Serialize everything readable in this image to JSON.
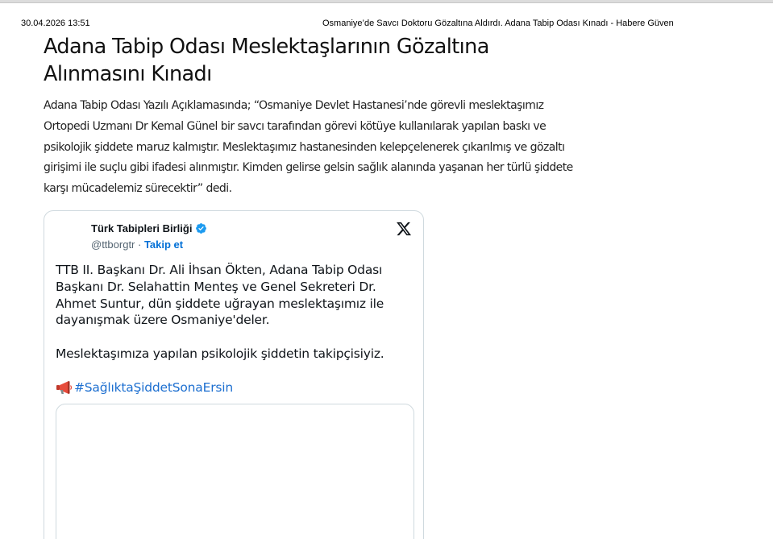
{
  "print_header": {
    "date": "30.04.2026 13:51",
    "title": "Osmaniye’de Savcı Doktoru Gözaltına Aldırdı. Adana Tabip Odası Kınadı - Habere Güven"
  },
  "article": {
    "headline": "Adana Tabip Odası Meslektaşlarının Gözaltına Alınmasını Kınadı",
    "body": "Adana Tabip Odası Yazılı Açıklamasında; “Osmaniye Devlet Hastanesi’nde görevli meslektaşımız Ortopedi Uzmanı Dr Kemal Günel bir savcı tarafından görevi kötüye kullanılarak yapılan baskı ve psikolojik şiddete maruz kalmıştır. Meslektaşımız hastanesinden kelepçelenerek çıkarılmış ve gözaltı girişimi ile suçlu gibi ifadesi alınmıştır. Kimden gelirse gelsin sağlık alanında yaşanan her türlü şiddete karşı mücadelemiz sürecektir” dedi."
  },
  "tweet": {
    "author_name": "Türk Tabipleri Birliği",
    "handle": "@ttborgtr",
    "separator": " · ",
    "follow_label": "Takip et",
    "paragraph1": "TTB II. Başkanı Dr. Ali İhsan Ökten, Adana Tabip Odası Başkanı Dr. Selahattin Menteş ve Genel Sekreteri Dr. Ahmet Suntur, dün şiddete uğrayan meslektaşımız ile dayanışmak üzere Osmaniye'deler.",
    "paragraph2": "Meslektaşımıza yapılan psikolojik şiddetin takipçisiyiz.",
    "hashtag": "#SağlıktaŞiddetSonaErsin",
    "icons": {
      "verified": "verified-badge-icon",
      "logo": "x-logo-icon",
      "megaphone": "megaphone-icon"
    },
    "colors": {
      "link": "#1d6fd0",
      "follow": "#006fd6",
      "verified": "#1d9bf0",
      "border": "#cfd9de"
    }
  }
}
